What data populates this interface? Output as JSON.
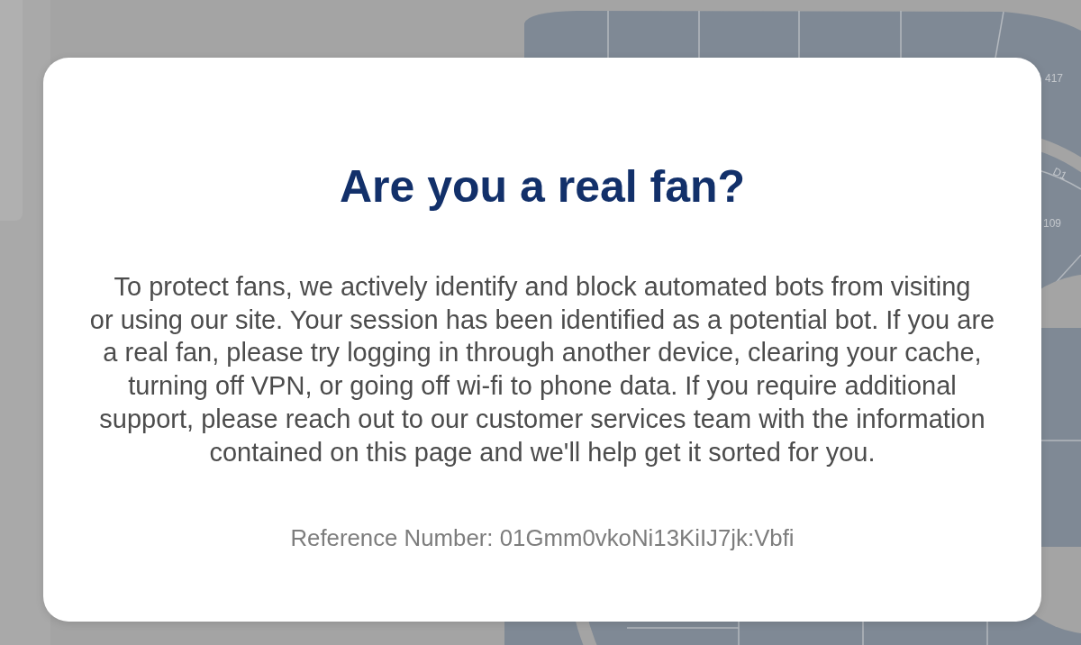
{
  "background": {
    "seat_map": {
      "section_labels": [
        "417",
        "D1",
        "109"
      ]
    }
  },
  "dialog": {
    "title": "Are you a real fan?",
    "message_lines": [
      "To protect fans, we actively identify and block automated bots from visiting",
      "or using our site. Your session has been identified as a potential bot. If you are",
      "a real fan, please try logging in through another device, clearing your cache,",
      "turning off VPN, or going off wi-fi to phone data. If you require additional",
      "support, please reach out to our customer services team with the information",
      "contained on this page and we'll help get it sorted for you."
    ],
    "reference": "Reference Number: 01Gmm0vkoNi13KiIJ7jk:Vbfi"
  }
}
